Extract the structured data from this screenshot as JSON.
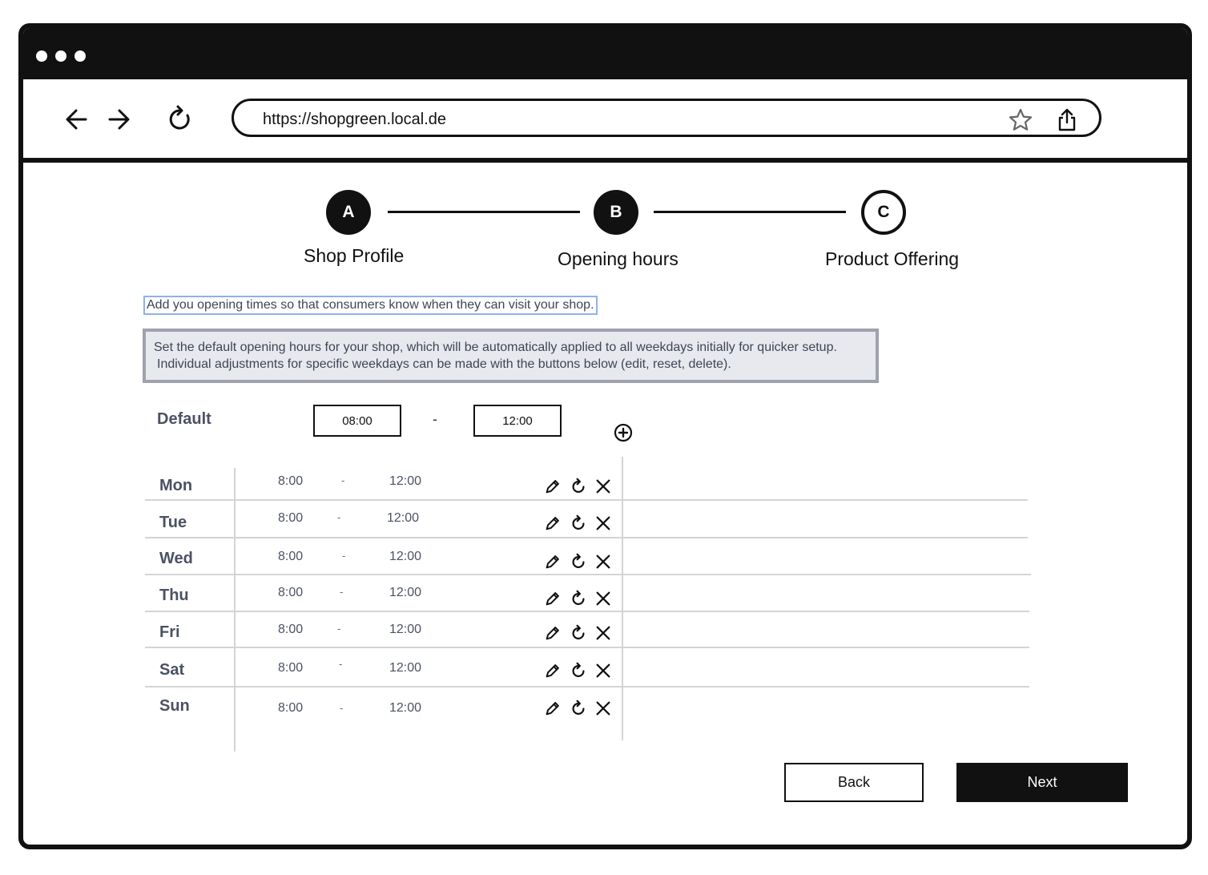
{
  "browser": {
    "url": "https://shopgreen.local.de"
  },
  "stepper": {
    "steps": [
      {
        "letter": "A",
        "label": "Shop Profile",
        "state": "completed"
      },
      {
        "letter": "B",
        "label": "Opening hours",
        "state": "active"
      },
      {
        "letter": "C",
        "label": "Product Offering",
        "state": "upcoming"
      }
    ]
  },
  "intro": "Add you opening times so that consumers know when they can visit your shop.",
  "info": {
    "line1": "Set the default opening hours for your shop, which will be automatically applied to all weekdays initially for quicker setup.",
    "line2": "Individual adjustments for specific weekdays can be made with the buttons below (edit, reset, delete)."
  },
  "default_hours": {
    "label": "Default",
    "from": "08:00",
    "separator": "-",
    "to": "12:00",
    "add_icon": "plus-circle-icon"
  },
  "days": [
    {
      "day": "Mon",
      "from": "8:00",
      "separator": "-",
      "to": "12:00"
    },
    {
      "day": "Tue",
      "from": "8:00",
      "separator": "-",
      "to": "12:00"
    },
    {
      "day": "Wed",
      "from": "8:00",
      "separator": "-",
      "to": "12:00"
    },
    {
      "day": "Thu",
      "from": "8:00",
      "separator": "-",
      "to": "12:00"
    },
    {
      "day": "Fri",
      "from": "8:00",
      "separator": "-",
      "to": "12:00"
    },
    {
      "day": "Sat",
      "from": "8:00",
      "separator": "-",
      "to": "12:00"
    },
    {
      "day": "Sun",
      "from": "8:00",
      "separator": "-",
      "to": "12:00"
    }
  ],
  "row_actions": [
    "pencil-icon",
    "reset-icon",
    "close-icon"
  ],
  "buttons": {
    "back": "Back",
    "next": "Next"
  },
  "colors": {
    "frame": "#111111",
    "muted_text": "#4a5263",
    "info_bg": "#e8e9ee",
    "info_border": "#9ea2ae",
    "highlight_border": "#8fb2e8"
  }
}
